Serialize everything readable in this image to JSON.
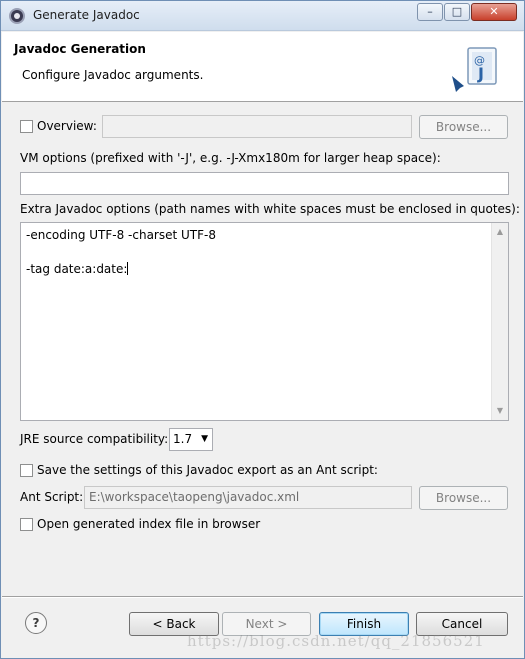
{
  "window": {
    "title": "Generate Javadoc",
    "controls": {
      "minimize": "–",
      "maximize": "□",
      "close": "✕"
    }
  },
  "header": {
    "title": "Javadoc Generation",
    "description": "Configure Javadoc arguments.",
    "icon": "javadoc-wizard-icon",
    "icon_at": "@",
    "icon_letter": "J"
  },
  "overview": {
    "label": "Overview:",
    "checked": false,
    "value": "",
    "browse_label": "Browse..."
  },
  "vm_options": {
    "label": "VM options (prefixed with '-J', e.g. -J-Xmx180m for larger heap space):",
    "value": ""
  },
  "extra_options": {
    "label": "Extra Javadoc options (path names with white spaces must be enclosed in quotes):",
    "lines": [
      "-encoding UTF-8 -charset UTF-8",
      "",
      "-tag date:a:date:"
    ]
  },
  "jre": {
    "label": "JRE source compatibility:",
    "selected": "1.7"
  },
  "ant": {
    "save_label": "Save the settings of this Javadoc export as an Ant script:",
    "save_checked": false,
    "script_label": "Ant Script:",
    "script_value": "E:\\workspace\\taopeng\\javadoc.xml",
    "browse_label": "Browse..."
  },
  "open_index": {
    "label": "Open generated index file in browser",
    "checked": false
  },
  "footer": {
    "help_label": "?",
    "back_label": "< Back",
    "next_label": "Next >",
    "finish_label": "Finish",
    "cancel_label": "Cancel",
    "watermark": "https://blog.csdn.net/qq_21856521"
  },
  "colors": {
    "accent": "#3c7fb1",
    "close_button": "#c8402b"
  }
}
